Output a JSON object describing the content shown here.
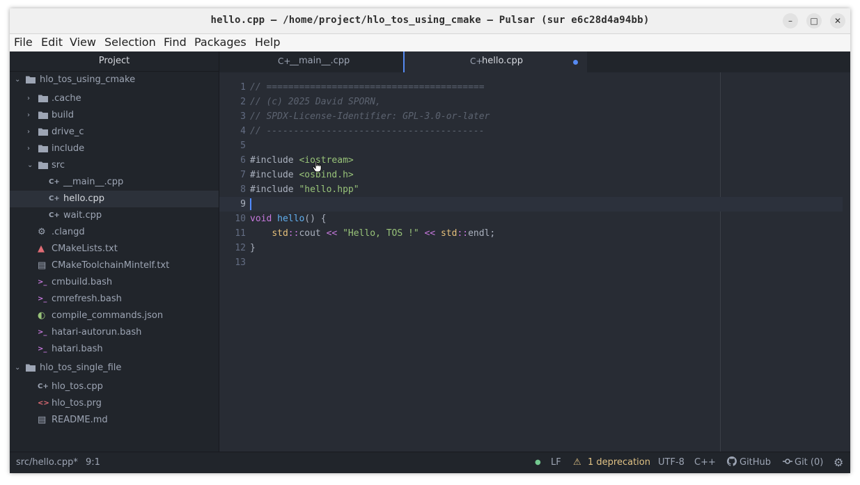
{
  "window": {
    "title": "hello.cpp — /home/project/hlo_tos_using_cmake — Pulsar (sur e6c28d4a94bb)",
    "controls": {
      "minimize": "–",
      "maximize": "□",
      "close": "✕"
    }
  },
  "menubar": {
    "items": [
      "File",
      "Edit",
      "View",
      "Selection",
      "Find",
      "Packages",
      "Help"
    ]
  },
  "tree": {
    "header": "Project",
    "items": [
      {
        "label": "hlo_tos_using_cmake",
        "icon": "folder-icon",
        "chev": "⌄"
      },
      {
        "label": ".cache",
        "icon": "folder-icon",
        "chev": "›"
      },
      {
        "label": "build",
        "icon": "folder-icon",
        "chev": "›"
      },
      {
        "label": "drive_c",
        "icon": "folder-icon",
        "chev": "›"
      },
      {
        "label": "include",
        "icon": "folder-icon",
        "chev": "›"
      },
      {
        "label": "src",
        "icon": "folder-icon",
        "chev": "⌄"
      },
      {
        "label": "__main__.cpp",
        "icon": "cpp-file-icon",
        "glyph": "C+"
      },
      {
        "label": "hello.cpp",
        "icon": "cpp-file-icon",
        "glyph": "C+"
      },
      {
        "label": "wait.cpp",
        "icon": "cpp-file-icon",
        "glyph": "C+"
      },
      {
        "label": ".clangd",
        "icon": "gear-icon",
        "glyph": "⚙"
      },
      {
        "label": "CMakeLists.txt",
        "icon": "cmake-icon",
        "glyph": "▲"
      },
      {
        "label": "CMakeToolchainMintelf.txt",
        "icon": "text-file-icon",
        "glyph": "▤"
      },
      {
        "label": "cmbuild.bash",
        "icon": "terminal-icon",
        "glyph": ">_"
      },
      {
        "label": "cmrefresh.bash",
        "icon": "terminal-icon",
        "glyph": ">_"
      },
      {
        "label": "compile_commands.json",
        "icon": "json-icon",
        "glyph": "◐"
      },
      {
        "label": "hatari-autorun.bash",
        "icon": "terminal-icon",
        "glyph": ">_"
      },
      {
        "label": "hatari.bash",
        "icon": "terminal-icon",
        "glyph": ">_"
      },
      {
        "label": "hlo_tos_single_file",
        "icon": "folder-icon",
        "chev": "⌄"
      },
      {
        "label": "hlo_tos.cpp",
        "icon": "cpp-file-icon",
        "glyph": "C+"
      },
      {
        "label": "hlo_tos.prg",
        "icon": "binary-icon",
        "glyph": "<>"
      },
      {
        "label": "README.md",
        "icon": "book-icon",
        "glyph": "▤"
      }
    ]
  },
  "tabs": [
    {
      "label": "__main__.cpp",
      "glyph": "C+"
    },
    {
      "label": "hello.cpp",
      "glyph": "C+"
    }
  ],
  "editor": {
    "line_numbers": [
      "1",
      "2",
      "3",
      "4",
      "5",
      "6",
      "7",
      "8",
      "9",
      "10",
      "11",
      "12",
      "13"
    ],
    "lines": [
      [
        {
          "t": "// ========================================",
          "c": "comment"
        }
      ],
      [
        {
          "t": "// (c) 2025 David SPORN,",
          "c": "comment"
        }
      ],
      [
        {
          "t": "// SPDX-License-Identifier: GPL-3.0-or-later",
          "c": "comment"
        }
      ],
      [
        {
          "t": "// ----------------------------------------",
          "c": "comment"
        }
      ],
      [],
      [
        {
          "t": "#include",
          "c": "punct"
        },
        {
          "t": " ",
          "c": "punct"
        },
        {
          "t": "<iostream>",
          "c": "string"
        }
      ],
      [
        {
          "t": "#include",
          "c": "punct"
        },
        {
          "t": " ",
          "c": "punct"
        },
        {
          "t": "<osbind.h>",
          "c": "string"
        }
      ],
      [
        {
          "t": "#include",
          "c": "punct"
        },
        {
          "t": " ",
          "c": "punct"
        },
        {
          "t": "\"hello.hpp\"",
          "c": "string"
        }
      ],
      [],
      [
        {
          "t": "void",
          "c": "keyword"
        },
        {
          "t": " ",
          "c": "punct"
        },
        {
          "t": "hello",
          "c": "fn"
        },
        {
          "t": "() {",
          "c": "punct"
        }
      ],
      [
        {
          "t": "    ",
          "c": "punct"
        },
        {
          "t": "std",
          "c": "type"
        },
        {
          "t": "::",
          "c": "op"
        },
        {
          "t": "cout ",
          "c": "punct"
        },
        {
          "t": "<<",
          "c": "op"
        },
        {
          "t": " ",
          "c": "punct"
        },
        {
          "t": "\"Hello, TOS !\"",
          "c": "string"
        },
        {
          "t": " ",
          "c": "punct"
        },
        {
          "t": "<<",
          "c": "op"
        },
        {
          "t": " ",
          "c": "punct"
        },
        {
          "t": "std",
          "c": "type"
        },
        {
          "t": "::",
          "c": "op"
        },
        {
          "t": "endl;",
          "c": "punct"
        }
      ],
      [
        {
          "t": "}",
          "c": "punct"
        }
      ],
      []
    ],
    "current_line": 9
  },
  "status": {
    "path": "src/hello.cpp*",
    "position": "9:1",
    "line_ending": "LF",
    "deprecation": "1 deprecation",
    "encoding": "UTF-8",
    "grammar": "C++",
    "github": "GitHub",
    "git": "Git (0)"
  },
  "colors": {
    "accent": "#568af2",
    "background": "#282c34",
    "panel": "#21252b",
    "comment": "#5c6370",
    "string": "#98c379",
    "keyword": "#c678dd",
    "function": "#61afef",
    "type": "#e5c07b",
    "warning": "#e0c285"
  }
}
